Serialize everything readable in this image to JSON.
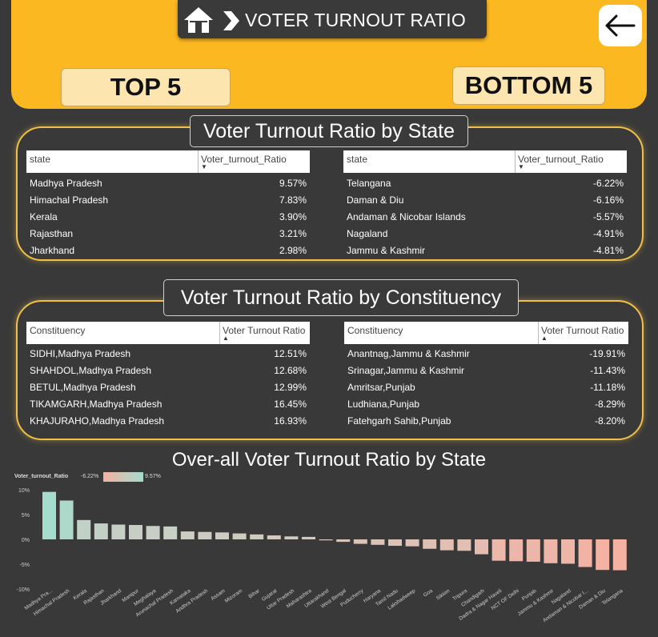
{
  "header": {
    "title": "VOTER TURNOUT RATIO",
    "icons": {
      "home": "home-icon",
      "chevron": "chevron-right-icon",
      "back": "back-arrow-icon"
    },
    "top_label": "TOP 5",
    "bottom_label": "BOTTOM 5",
    "colors": {
      "accent": "#fbb821",
      "background": "#393939",
      "panel_border": "#f0c048"
    }
  },
  "state_panel": {
    "title": "Voter Turnout Ratio by State",
    "top": {
      "col1": "state",
      "col2": "Voter_turnout_Ratio",
      "rows": [
        {
          "name": "Madhya Pradesh",
          "value": "9.57%"
        },
        {
          "name": "Himachal Pradesh",
          "value": "7.83%"
        },
        {
          "name": "Kerala",
          "value": "3.90%"
        },
        {
          "name": "Rajasthan",
          "value": "3.21%"
        },
        {
          "name": "Jharkhand",
          "value": "2.98%"
        }
      ]
    },
    "bottom": {
      "col1": "state",
      "col2": "Voter_turnout_Ratio",
      "rows": [
        {
          "name": "Telangana",
          "value": "-6.22%"
        },
        {
          "name": "Daman & Diu",
          "value": "-6.16%"
        },
        {
          "name": "Andaman & Nicobar Islands",
          "value": "-5.57%"
        },
        {
          "name": "Nagaland",
          "value": "-4.91%"
        },
        {
          "name": "Jammu & Kashmir",
          "value": "-4.81%"
        }
      ]
    }
  },
  "constituency_panel": {
    "title": "Voter Turnout Ratio by Constituency",
    "top": {
      "col1": "Constituency",
      "col2": "Voter Turnout Ratio",
      "rows": [
        {
          "name": "SIDHI,Madhya Pradesh",
          "value": "12.51%"
        },
        {
          "name": "SHAHDOL,Madhya Pradesh",
          "value": "12.68%"
        },
        {
          "name": "BETUL,Madhya Pradesh",
          "value": "12.99%"
        },
        {
          "name": "TIKAMGARH,Madhya Pradesh",
          "value": "16.45%"
        },
        {
          "name": "KHAJURAHO,Madhya Pradesh",
          "value": "16.93%"
        }
      ]
    },
    "bottom": {
      "col1": "Constituency",
      "col2": "Voter Turnout Ratio",
      "rows": [
        {
          "name": "Anantnag,Jammu & Kashmir",
          "value": "-19.91%"
        },
        {
          "name": "Srinagar,Jammu & Kashmir",
          "value": "-11.43%"
        },
        {
          "name": "Amritsar,Punjab",
          "value": "-11.18%"
        },
        {
          "name": "Ludhiana,Punjab",
          "value": "-8.29%"
        },
        {
          "name": "Fatehgarh Sahib,Punjab",
          "value": "-8.20%"
        }
      ]
    }
  },
  "overall": {
    "title": "Over-all Voter Turnout Ratio by State",
    "legend_label": "Voter_turnout_Ratio",
    "legend_min": "-6.22%",
    "legend_max": "9.57%"
  },
  "chart_data": {
    "type": "bar",
    "title": "Over-all Voter Turnout Ratio by State",
    "ylim": [
      -7,
      10
    ],
    "yticks": [
      "10%",
      "5%",
      "0%",
      "-5%",
      "-10%"
    ],
    "ytick_values": [
      10,
      5,
      0,
      -5,
      -10
    ],
    "color_scale": {
      "min": -6.22,
      "max": 9.57,
      "min_color": "#f5b1a2",
      "max_color": "#a4dccd"
    },
    "categories": [
      "Madhya Pra...",
      "Himachal Pradesh",
      "Kerala",
      "Rajasthan",
      "Jharkhand",
      "Manipur",
      "Meghalaya",
      "Arunachal Pradesh",
      "Karnataka",
      "Andhra Pradesh",
      "Assam",
      "Mizoram",
      "Bihar",
      "Gujarat",
      "Uttar Pradesh",
      "Maharashtra",
      "Uttarakhand",
      "West Bengal",
      "Puducherry",
      "Haryana",
      "Tamil Nadu",
      "Lakshadweep",
      "Goa",
      "Sikkim",
      "Tripura",
      "Chandigarh",
      "Dadra & Nagar Haveli",
      "NCT OF Delhi",
      "Punjab",
      "Jammu & Kashmir",
      "Nagaland",
      "Andaman & Nicobar I...",
      "Daman & Diu",
      "Telangana"
    ],
    "values": [
      9.57,
      7.83,
      3.9,
      3.21,
      2.98,
      2.9,
      2.7,
      2.6,
      1.6,
      1.5,
      1.4,
      1.2,
      1.0,
      0.8,
      0.6,
      0.5,
      -0.2,
      -0.5,
      -0.9,
      -1.1,
      -1.3,
      -1.4,
      -1.9,
      -2.2,
      -2.3,
      -3.0,
      -4.3,
      -4.4,
      -4.5,
      -4.81,
      -4.91,
      -5.57,
      -6.16,
      -6.22
    ]
  }
}
